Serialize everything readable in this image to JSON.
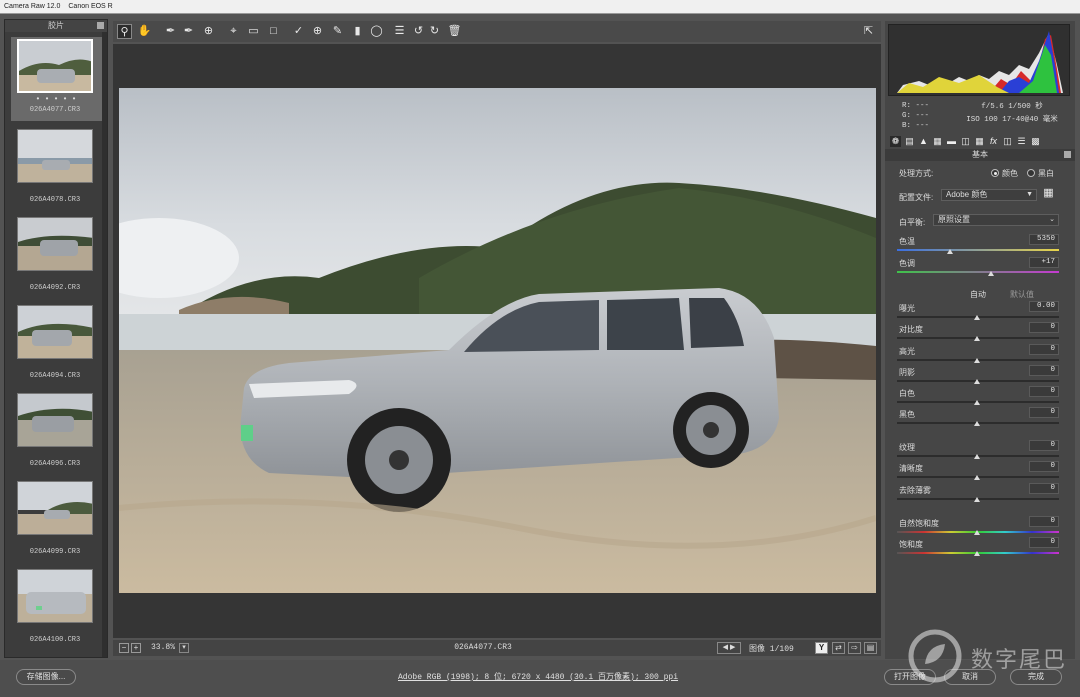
{
  "window": {
    "title": "Camera Raw 12.0",
    "subtitle": "Canon EOS R"
  },
  "filmstrip": {
    "header": "胶片",
    "selected_dots": "• • • • •",
    "items": [
      {
        "label": "026A4077.CR3"
      },
      {
        "label": "026A4078.CR3"
      },
      {
        "label": "026A4092.CR3"
      },
      {
        "label": "026A4094.CR3"
      },
      {
        "label": "026A4096.CR3"
      },
      {
        "label": "026A4099.CR3"
      },
      {
        "label": "026A4100.CR3"
      }
    ]
  },
  "toolbar": {
    "tools": [
      "zoom-icon",
      "hand-icon",
      "white-balance-icon",
      "color-sampler-icon",
      "targeted-adjust-icon",
      "crop-icon",
      "straighten-icon",
      "transform-icon",
      "spot-removal-icon",
      "red-eye-icon",
      "adjustment-brush-icon",
      "graduated-filter-icon",
      "radial-filter-icon",
      "preferences-icon",
      "rotate-left-icon",
      "rotate-right-icon",
      "trash-icon"
    ]
  },
  "status": {
    "zoom": "33.8%",
    "filename": "026A4077.CR3",
    "image_count": "图像 1/109",
    "view_toggle": "Y"
  },
  "footer": {
    "save_label": "存储图像...",
    "workflow": "Adobe RGB (1998); 8 位; 6720 x 4480 (30.1 百万像素); 300 ppi",
    "open_label": "打开图像",
    "cancel_label": "取消",
    "done_label": "完成",
    "watermark": "数字尾巴"
  },
  "readout": {
    "r": "R:  ---",
    "g": "G:  ---",
    "b": "B:  ---",
    "exposure": "f/5.6  1/500 秒",
    "iso_lens": "ISO 100  17-40@40 毫米"
  },
  "basic": {
    "section_title": "基本",
    "treatment_label": "处理方式:",
    "color_label": "颜色",
    "bw_label": "黑白",
    "profile_label": "配置文件:",
    "profile_value": "Adobe 颜色",
    "wb_label": "白平衡:",
    "wb_value": "原照设置",
    "temp_label": "色温",
    "temp_value": "5350",
    "tint_label": "色调",
    "tint_value": "+17",
    "auto_label": "自动",
    "default_label": "默认值",
    "exposure_label": "曝光",
    "exposure_value": "0.00",
    "contrast_label": "对比度",
    "contrast_value": "0",
    "highlights_label": "高光",
    "highlights_value": "0",
    "shadows_label": "阴影",
    "shadows_value": "0",
    "whites_label": "白色",
    "whites_value": "0",
    "blacks_label": "黑色",
    "blacks_value": "0",
    "texture_label": "纹理",
    "texture_value": "0",
    "clarity_label": "清晰度",
    "clarity_value": "0",
    "dehaze_label": "去除薄雾",
    "dehaze_value": "0",
    "vibrance_label": "自然饱和度",
    "vibrance_value": "0",
    "saturation_label": "饱和度",
    "saturation_value": "0"
  }
}
